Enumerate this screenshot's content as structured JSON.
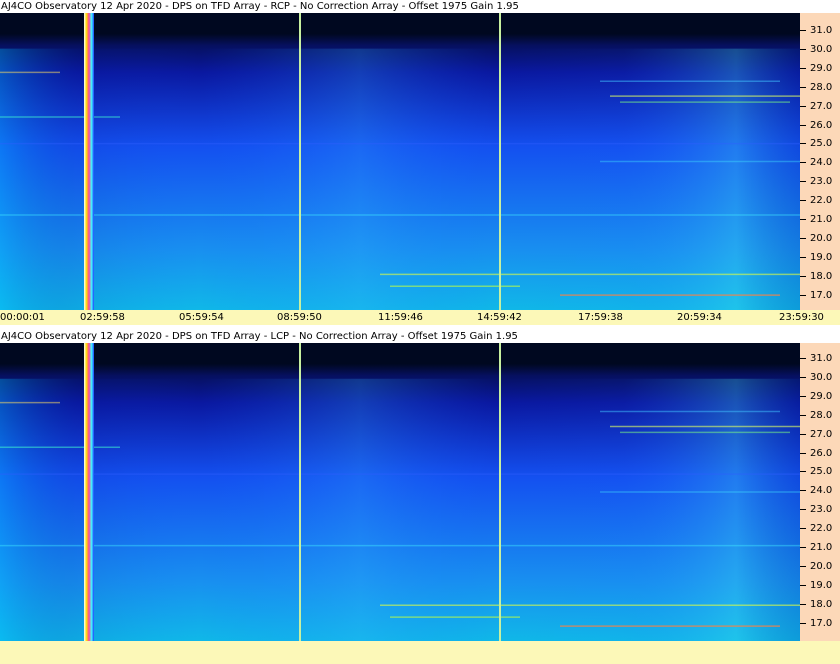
{
  "panels": [
    {
      "title": "AJ4CO Observatory 12 Apr 2020 - DPS on TFD Array  - RCP  -  No Correction Array  -  Offset 1975  Gain 1.95",
      "freq_labels": [
        "31.0",
        "30.0",
        "29.0",
        "28.0",
        "27.0",
        "26.0",
        "25.0",
        "24.0",
        "23.0",
        "22.0",
        "21.0",
        "20.0",
        "19.0",
        "18.0",
        "17.0"
      ],
      "time_labels": [
        "00:00:01",
        "02:59:58",
        "05:59:54",
        "08:59:50",
        "11:59:46",
        "14:59:42",
        "17:59:38",
        "20:59:34",
        "23:59:30"
      ]
    },
    {
      "title": "AJ4CO Observatory 12 Apr 2020 - DPS on TFD Array  - LCP  -  No Correction Array  -  Offset 1975  Gain 1.95",
      "freq_labels": [
        "31.0",
        "30.0",
        "29.0",
        "28.0",
        "27.0",
        "26.0",
        "25.0",
        "24.0",
        "23.0",
        "22.0",
        "21.0",
        "20.0",
        "19.0",
        "18.0",
        "17.0"
      ]
    }
  ],
  "colors": {
    "scale_bg": "#fcd8b8",
    "time_bg": "#fcf8b8",
    "marker_line": "#c8f0a0",
    "spectro_dark": "#000820",
    "spectro_deep": "#0a18a0",
    "spectro_mid": "#1450f0",
    "spectro_cyan": "#10b8e8"
  }
}
